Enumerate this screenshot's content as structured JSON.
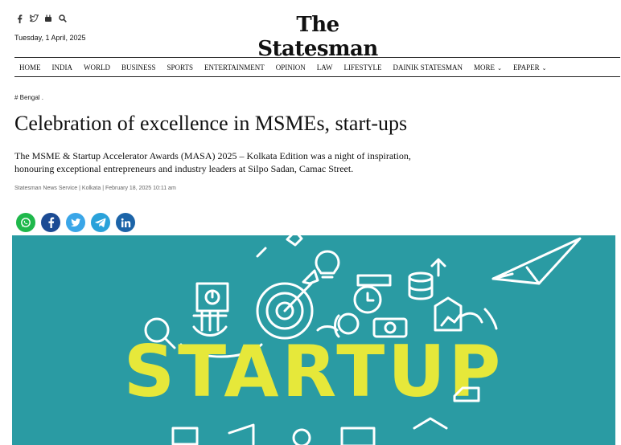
{
  "header": {
    "social_icons": [
      "facebook-icon",
      "twitter-icon",
      "youtube-icon",
      "search-icon"
    ],
    "date": "Tuesday, 1 April, 2025",
    "logo": "The Statesman"
  },
  "nav": {
    "items": [
      "HOME",
      "INDIA",
      "WORLD",
      "BUSINESS",
      "SPORTS",
      "ENTERTAINMENT",
      "OPINION",
      "LAW",
      "LIFESTYLE",
      "DAINIK STATESMAN",
      "MORE",
      "EPAPER"
    ]
  },
  "article": {
    "tag": "# Bengal .",
    "title": "Celebration of excellence in MSMEs, start-ups",
    "summary": "The MSME & Startup Accelerator Awards (MASA) 2025 – Kolkata Edition was a night of inspiration, honouring exceptional entrepreneurs and industry leaders at Silpo Sadan, Camac Street.",
    "byline": "Statesman News Service | Kolkata | February 18, 2025 10:11 am",
    "share_icons": [
      "whatsapp-icon",
      "facebook-icon",
      "twitter-icon",
      "telegram-icon",
      "linkedin-icon"
    ]
  },
  "hero": {
    "word": "STARTUP",
    "bg_color": "#2a9ba3",
    "text_color": "#e6e83a"
  }
}
